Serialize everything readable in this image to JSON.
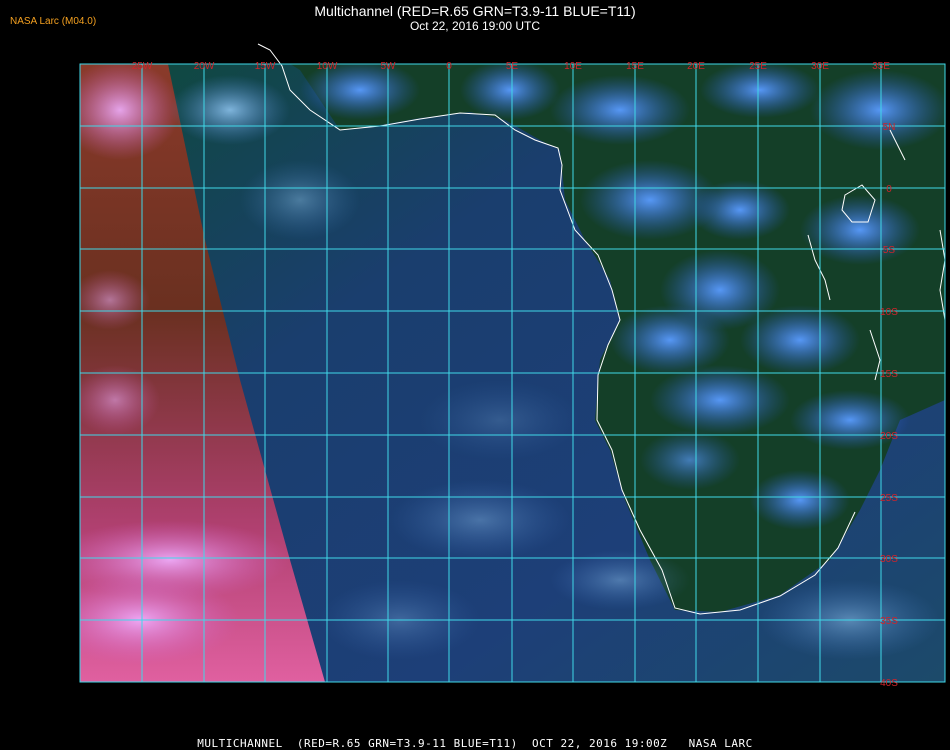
{
  "header": {
    "org_label": "NASA Larc (M04.0)",
    "title": "Multichannel (RED=R.65 GRN=T3.9-11 BLUE=T11)",
    "subtitle": "Oct 22, 2016 19:00 UTC"
  },
  "footer": {
    "caption": "MULTICHANNEL  (RED=R.65 GRN=T3.9-11 BLUE=T11)  OCT 22, 2016 19:00Z   NASA LARC"
  },
  "map": {
    "lon_labels": [
      "25W",
      "20W",
      "15W",
      "10W",
      "5W",
      "0",
      "5E",
      "10E",
      "15E",
      "20E",
      "25E",
      "30E",
      "35E"
    ],
    "lat_labels": [
      "5N",
      "0",
      "5S",
      "10S",
      "15S",
      "20S",
      "25S",
      "30S",
      "35S",
      "40S"
    ],
    "colors": {
      "grid": "#40d8e8",
      "coast": "#ffffff",
      "label": "#d0242a",
      "ocean": "#1a3a6a",
      "land": "#123c20"
    }
  }
}
